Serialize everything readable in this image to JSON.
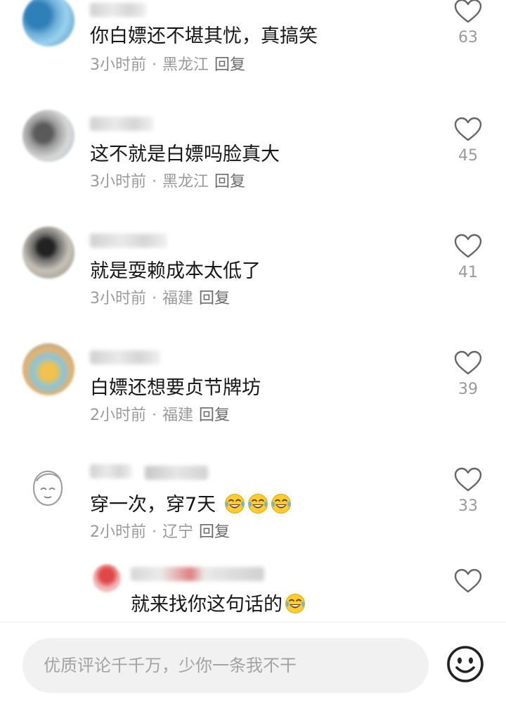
{
  "comments": [
    {
      "text": "你白嫖还不堪其忧，真搞笑",
      "time": "3小时前",
      "location": "黑龙江",
      "reply": "回复",
      "likes": "63"
    },
    {
      "text": "这不就是白嫖吗脸真大",
      "time": "3小时前",
      "location": "黑龙江",
      "reply": "回复",
      "likes": "45"
    },
    {
      "text": "就是耍赖成本太低了",
      "time": "3小时前",
      "location": "福建",
      "reply": "回复",
      "likes": "41"
    },
    {
      "text": "白嫖还想要贞节牌坊",
      "time": "2小时前",
      "location": "福建",
      "reply": "回复",
      "likes": "39"
    },
    {
      "text": "穿一次，穿7天",
      "emojis": [
        "laugh-cry",
        "laugh-cry",
        "laugh-cry"
      ],
      "time": "2小时前",
      "location": "辽宁",
      "reply": "回复",
      "likes": "33"
    }
  ],
  "nested_reply": {
    "text": "就来找你这句话的",
    "emoji": "laugh-cry"
  },
  "separator": "·",
  "input": {
    "placeholder": "优质评论千千万，少你一条我不干"
  },
  "icons": {
    "like": "heart-outline-icon",
    "emoji_button": "smiley-icon",
    "inline_emoji": "laugh-cry-emoji"
  },
  "colors": {
    "text": "#171717",
    "meta": "#9a9a9a",
    "reply": "#6b6b6b",
    "input_bg": "#f1f1f1",
    "icon": "#222222"
  }
}
